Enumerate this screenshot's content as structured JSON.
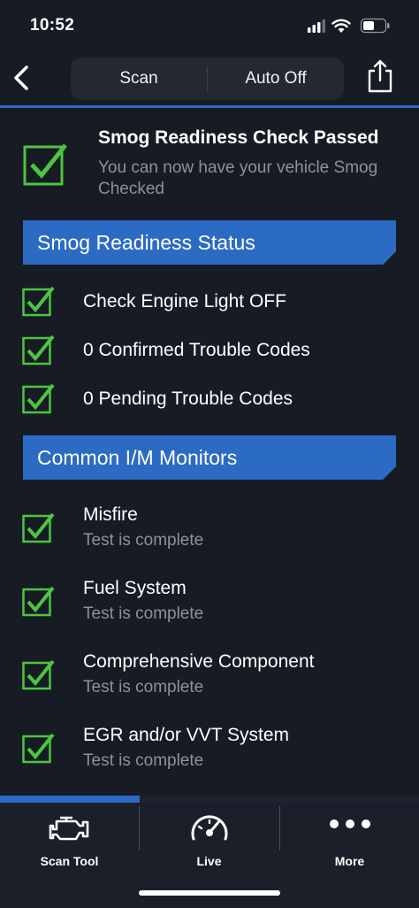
{
  "status_bar": {
    "time": "10:52"
  },
  "top_bar": {
    "segments": [
      "Scan",
      "Auto Off"
    ]
  },
  "summary": {
    "title": "Smog Readiness Check Passed",
    "subtitle": "You can now have your vehicle Smog Checked"
  },
  "readiness": {
    "header": "Smog Readiness Status",
    "items": [
      "Check Engine Light OFF",
      "0 Confirmed Trouble Codes",
      "0 Pending Trouble Codes"
    ]
  },
  "monitors": {
    "header": "Common I/M Monitors",
    "items": [
      {
        "name": "Misfire",
        "status": "Test is complete"
      },
      {
        "name": "Fuel System",
        "status": "Test is complete"
      },
      {
        "name": "Comprehensive Component",
        "status": "Test is complete"
      },
      {
        "name": "EGR and/or VVT System",
        "status": "Test is complete"
      }
    ]
  },
  "tab_bar": {
    "tabs": [
      {
        "label": "Scan Tool",
        "icon": "engine-icon"
      },
      {
        "label": "Live",
        "icon": "gauge-icon"
      },
      {
        "label": "More",
        "icon": "more-dots-icon"
      }
    ],
    "active_tab_index": 0
  },
  "colors": {
    "background": "#171b24",
    "accent_blue": "#2c6bc4",
    "check_green": "#4cc540",
    "secondary_text": "#8d9199"
  }
}
